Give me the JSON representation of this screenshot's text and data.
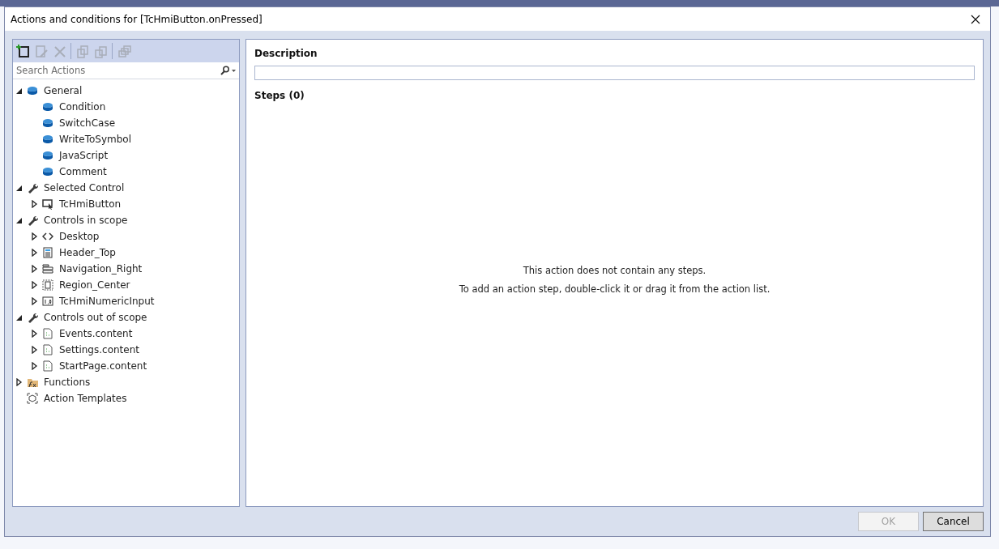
{
  "window": {
    "title": "Actions and conditions for [TcHmiButton.onPressed]"
  },
  "toolbar": [
    {
      "kind": "add",
      "disabled": false
    },
    {
      "kind": "edit",
      "disabled": true
    },
    {
      "kind": "delete",
      "disabled": true
    },
    {
      "kind": "copy",
      "disabled": true
    },
    {
      "kind": "paste",
      "disabled": true
    },
    {
      "kind": "duplicate",
      "disabled": true
    }
  ],
  "search": {
    "placeholder": "Search Actions"
  },
  "tree": [
    {
      "label": "General",
      "kind": "cube",
      "expanded": true,
      "children": [
        {
          "label": "Condition",
          "kind": "cube"
        },
        {
          "label": "SwitchCase",
          "kind": "cube"
        },
        {
          "label": "WriteToSymbol",
          "kind": "cube"
        },
        {
          "label": "JavaScript",
          "kind": "cube"
        },
        {
          "label": "Comment",
          "kind": "cube"
        }
      ]
    },
    {
      "label": "Selected Control",
      "kind": "wrench",
      "expanded": true,
      "children": [
        {
          "label": "TcHmiButton",
          "kind": "control",
          "expanded": false
        }
      ]
    },
    {
      "label": "Controls in scope",
      "kind": "wrench",
      "expanded": true,
      "children": [
        {
          "label": "Desktop",
          "kind": "code",
          "expanded": false
        },
        {
          "label": "Header_Top",
          "kind": "page",
          "expanded": false
        },
        {
          "label": "Navigation_Right",
          "kind": "panel",
          "expanded": false
        },
        {
          "label": "Region_Center",
          "kind": "region",
          "expanded": false
        },
        {
          "label": "TcHmiNumericInput",
          "kind": "numeric",
          "expanded": false
        }
      ]
    },
    {
      "label": "Controls out of scope",
      "kind": "wrench",
      "expanded": true,
      "children": [
        {
          "label": "Events.content",
          "kind": "file",
          "expanded": false
        },
        {
          "label": "Settings.content",
          "kind": "file",
          "expanded": false
        },
        {
          "label": "StartPage.content",
          "kind": "file",
          "expanded": false
        }
      ]
    },
    {
      "label": "Functions",
      "kind": "functions",
      "expanded": false
    },
    {
      "label": "Action Templates",
      "kind": "template"
    }
  ],
  "description": {
    "label": "Description"
  },
  "steps": {
    "label": "Steps (0)",
    "empty_message": "This action does not contain any steps.",
    "hint": "To add an action step, double-click it or drag it from the action list."
  },
  "buttons": [
    {
      "label": "OK",
      "disabled": true
    },
    {
      "label": "Cancel",
      "disabled": false
    }
  ]
}
